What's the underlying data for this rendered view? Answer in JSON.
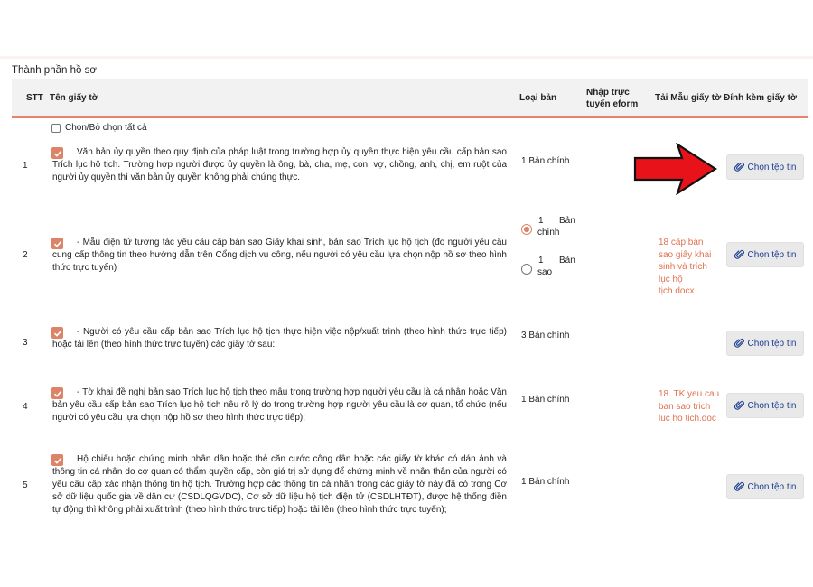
{
  "section_title": "Thành phần hồ sơ",
  "table": {
    "headers": {
      "stt": "STT",
      "name": "Tên giấy tờ",
      "type": "Loại bản",
      "eform": "Nhập trực tuyến eform",
      "template": "Tải Mẫu giấy tờ",
      "attach": "Đính kèm giấy tờ"
    },
    "select_all_label": "Chọn/Bỏ chọn tất cả",
    "attach_button_label": "Chọn tệp tin",
    "rows": [
      {
        "stt": "1",
        "checked": true,
        "description": "Văn bản ủy quyền theo quy định của pháp luật trong trường hợp ủy quyền thực hiện yêu cầu cấp bản sao Trích lục hộ tịch. Trường hợp người được ủy quyền là ông, bà, cha, mẹ, con, vợ, chồng, anh, chị, em ruột của người ủy quyền thì văn bản ủy quyền không phải chứng thực.",
        "type": "1 Bản chính",
        "template": ""
      },
      {
        "stt": "2",
        "checked": true,
        "description": "- Mẫu điện tử tương tác yêu cầu cấp bản sao Giấy khai sinh, bản sao Trích lục hộ tịch (đo người yêu cầu cung cấp thông tin theo hướng dẫn trên Cổng dịch vụ công, nếu người có yêu cầu lựa chọn nộp hồ sơ theo hình thức trực tuyến)",
        "type_options": [
          {
            "num": "1",
            "kind": "Bản",
            "sub": "chính",
            "selected": true
          },
          {
            "num": "1",
            "kind": "Bản",
            "sub": "sao",
            "selected": false
          }
        ],
        "template": "18 cấp bản sao giấy khai sinh và trích lục hộ tịch.docx"
      },
      {
        "stt": "3",
        "checked": true,
        "description": "- Người có yêu cầu cấp bản sao Trích lục hộ tịch thực hiện việc nộp/xuất trình (theo hình thức trực tiếp) hoặc tải lên (theo hình thức trực tuyến) các giấy tờ sau:",
        "type": "3 Bản chính",
        "template": ""
      },
      {
        "stt": "4",
        "checked": true,
        "description": "- Tờ khai đề nghị bản sao Trích lục hộ tịch theo mẫu trong trường hợp người yêu cầu là cá nhân hoặc Văn bản yêu cầu cấp bản sao Trích lục hộ tịch nêu rõ lý do trong trường hợp người yêu cầu là cơ quan, tổ chức (nếu người có yêu cầu lựa chọn nộp hồ sơ theo hình thức trực tiếp);",
        "type": "1 Bản chính",
        "template": "18. TK yeu cau ban sao trich luc ho tich.doc"
      },
      {
        "stt": "5",
        "checked": true,
        "description": "Hộ chiếu hoặc chứng minh nhân dân hoặc thẻ căn cước công dân hoặc các giấy tờ khác có dán ảnh và thông tin cá nhân do cơ quan có thẩm quyền cấp, còn giá trị sử dụng để chứng minh về nhân thân của người có yêu cầu cấp xác nhận thông tin hộ tịch. Trường hợp các thông tin cá nhân trong các giấy tờ này đã có trong Cơ sở dữ liệu quốc gia về dân cư (CSDLQGVDC), Cơ sở dữ liệu hộ tịch điện tử (CSDLHTĐT), được hệ thống điền tự động thì không phải xuất trình (theo hình thức trực tiếp) hoặc tải lên (theo hình thức trực tuyến);",
        "type": "1 Bản chính",
        "template": ""
      }
    ]
  },
  "colors": {
    "accent": "#dd8468",
    "link": "#e0714f",
    "button_text": "#1a3d8f",
    "arrow": "#e8131a"
  }
}
